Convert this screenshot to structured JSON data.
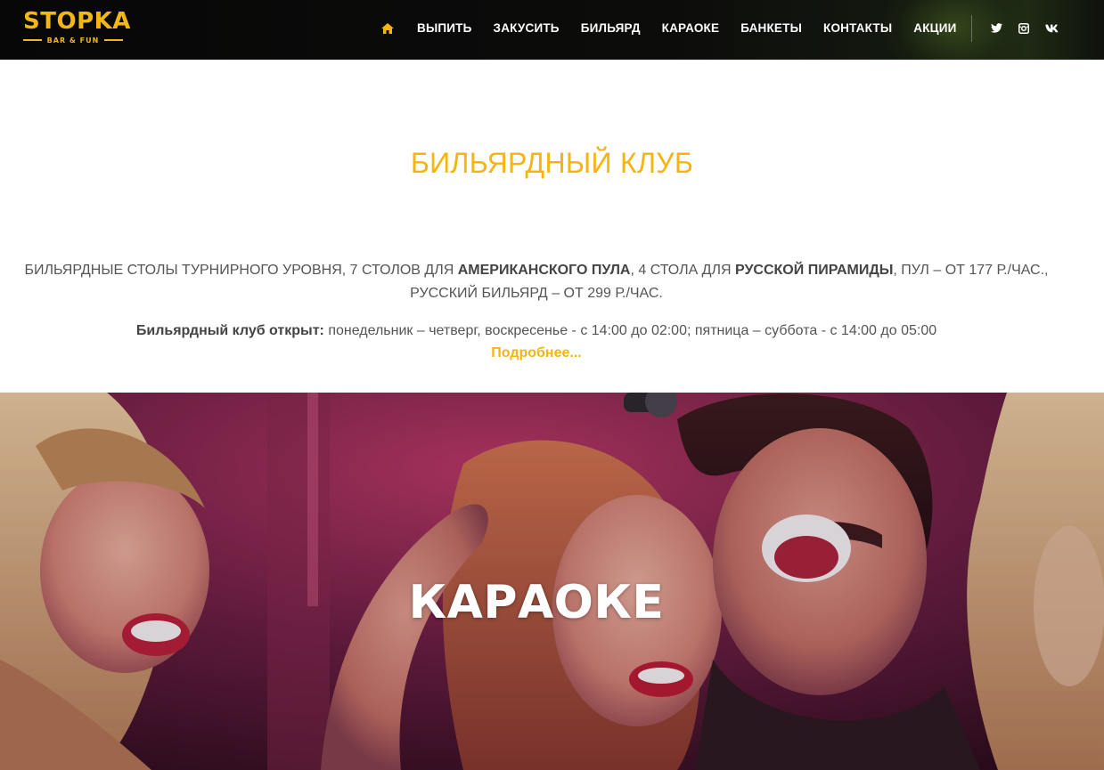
{
  "header": {
    "logo": {
      "title": "STOPKA",
      "subtitle": "BAR & FUN"
    },
    "nav": {
      "home_icon": "home-icon",
      "items": [
        {
          "label": "ВЫПИТЬ"
        },
        {
          "label": "ЗАКУСИТЬ"
        },
        {
          "label": "БИЛЬЯРД"
        },
        {
          "label": "КАРАОКЕ"
        },
        {
          "label": "БАНКЕТЫ"
        },
        {
          "label": "КОНТАКТЫ"
        },
        {
          "label": "АКЦИИ"
        }
      ]
    },
    "social": [
      {
        "icon": "twitter-icon"
      },
      {
        "icon": "instagram-icon"
      },
      {
        "icon": "vk-icon"
      }
    ]
  },
  "billiard": {
    "title": "БИЛЬЯРДНЫЙ КЛУБ",
    "description": {
      "part1": "БИЛЬЯРДНЫЕ СТОЛЫ ТУРНИРНОГО УРОВНЯ, 7 СТОЛОВ ДЛЯ ",
      "bold1": "АМЕРИКАНСКОГО ПУЛА",
      "part2": ", 4 СТОЛА ДЛЯ ",
      "bold2": "РУССКОЙ ПИРАМИДЫ",
      "part3": ", ПУЛ – ОТ 177 Р./ЧАС., РУССКИЙ БИЛЬЯРД – ОТ 299 Р./ЧАС."
    },
    "hours": {
      "label": "Бильярдный клуб открыт:",
      "text": " понедельник – четверг, воскресенье - с 14:00 до 02:00; пятница – суббота - с 14:00 до 05:00"
    },
    "more_link": "Подробнее..."
  },
  "karaoke": {
    "title": "КАРАОКЕ"
  },
  "colors": {
    "accent": "#f5b40f",
    "header_bg": "#0a0a0a",
    "text": "#555555"
  }
}
